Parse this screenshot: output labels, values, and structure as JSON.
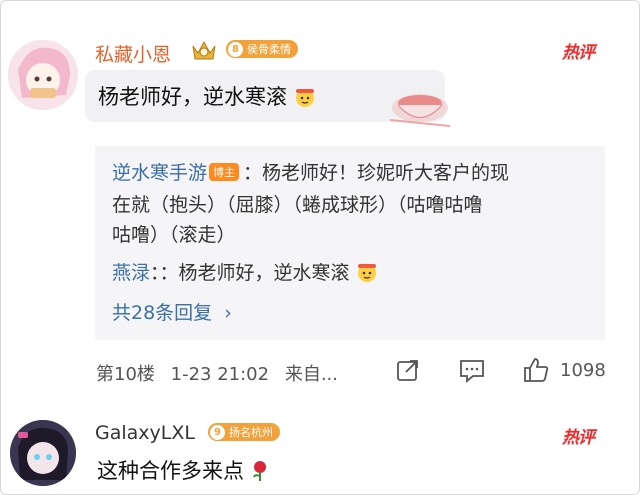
{
  "comments": [
    {
      "username": "私藏小恩",
      "fan_badge": {
        "level": "8",
        "text": "侯骨柔情",
        "color": "#f2a23a"
      },
      "hot_label": "热评",
      "text": "杨老师好，逆水寒滚",
      "replies": {
        "reply1_author": "逆水寒手游",
        "reply1_role": "博主",
        "reply1_line1": "：杨老师好！珍妮听大客户的现",
        "reply1_line2": "在就（抱头）（屈膝）（蜷成球形）（咕噜咕噜",
        "reply1_line3": "咕噜）（滚走）",
        "reply2_author": "燕渌",
        "reply2_text": "：：杨老师好，逆水寒滚",
        "more": "共28条回复",
        "more_arrow": "›"
      },
      "floor": "第10楼",
      "time": "1-23 21:02",
      "source": "来自...",
      "likes": "1098"
    },
    {
      "username": "GalaxyLXL",
      "fan_badge": {
        "level": "9",
        "text": "扬名杭州",
        "color": "#f2a23a"
      },
      "hot_label": "热评",
      "text": "这种合作多来点"
    }
  ],
  "colors": {
    "link": "#3a6fa8",
    "hot": "#ef2b2b",
    "badge": "#f2a23a",
    "host_tag": "#ff8a1f"
  }
}
